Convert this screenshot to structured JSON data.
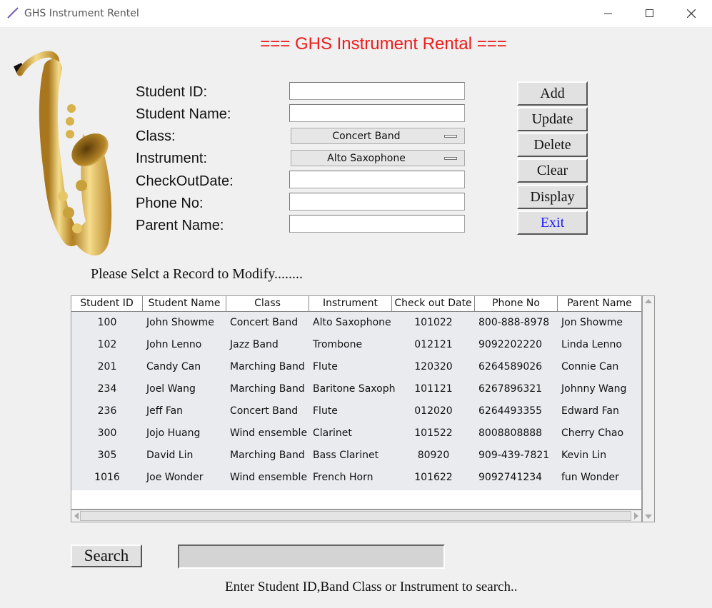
{
  "window": {
    "title": "GHS Instrument Rentel"
  },
  "heading": "=== GHS Instrument Rental ===",
  "form": {
    "labels": {
      "student_id": "Student ID:",
      "student_name": "Student Name:",
      "class": "Class:",
      "instrument": "Instrument:",
      "checkout_date": "CheckOutDate:",
      "phone_no": "Phone No:",
      "parent_name": "Parent Name:"
    },
    "values": {
      "student_id": "",
      "student_name": "",
      "class": "Concert Band",
      "instrument": "Alto Saxophone",
      "checkout_date": "",
      "phone_no": "",
      "parent_name": ""
    }
  },
  "buttons": {
    "add": "Add",
    "update": "Update",
    "delete": "Delete",
    "clear": "Clear",
    "display": "Display",
    "exit": "Exit",
    "search": "Search"
  },
  "prompt": "Please Selct a Record to Modify........",
  "table": {
    "columns": [
      "Student ID",
      "Student Name",
      "Class",
      "Instrument",
      "Check out Date",
      "Phone No",
      "Parent Name"
    ],
    "rows": [
      [
        "100",
        "John Showme",
        "Concert Band",
        "Alto Saxophone",
        "101022",
        "800-888-8978",
        "Jon Showme"
      ],
      [
        "102",
        "John Lenno",
        "Jazz Band",
        "Trombone",
        "012121",
        "9092202220",
        "Linda Lenno"
      ],
      [
        "201",
        "Candy Can",
        "Marching Band",
        "Flute",
        "120320",
        "6264589026",
        "Connie Can"
      ],
      [
        "234",
        "Joel Wang",
        "Marching Band",
        "Baritone Saxoph",
        "101121",
        "6267896321",
        "Johnny Wang"
      ],
      [
        "236",
        "Jeff Fan",
        "Concert Band",
        "Flute",
        "012020",
        "6264493355",
        "Edward Fan"
      ],
      [
        "300",
        "Jojo Huang",
        "Wind ensemble",
        "Clarinet",
        "101522",
        "8008808888",
        "Cherry Chao"
      ],
      [
        "305",
        "David Lin",
        "Marching Band",
        "Bass Clarinet",
        "80920",
        "909-439-7821",
        "Kevin Lin"
      ],
      [
        "1016",
        "Joe Wonder",
        "Wind ensemble",
        "French Horn",
        "101622",
        "9092741234",
        "fun Wonder"
      ]
    ]
  },
  "search": {
    "value": ""
  },
  "hint": "Enter Student ID,Band Class or Instrument to search..",
  "colors": {
    "heading": "#ee1c1c",
    "exit_text": "#1a1aff"
  }
}
